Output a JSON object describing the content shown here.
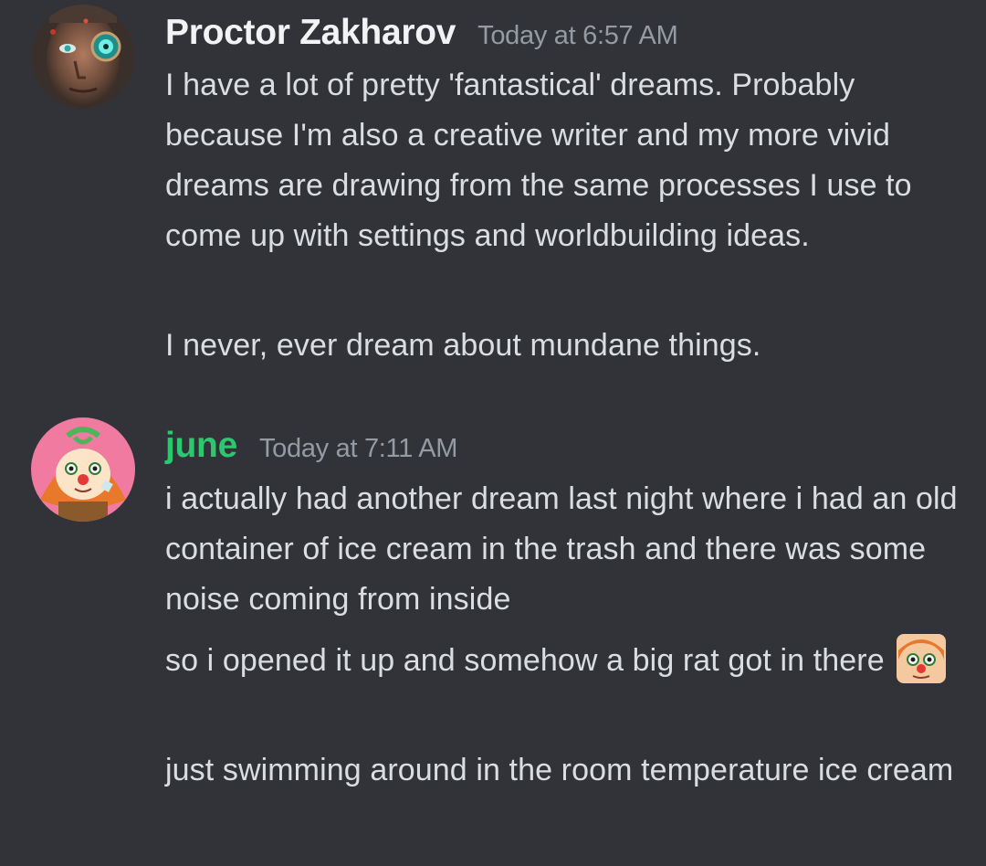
{
  "messages": [
    {
      "author": "Proctor Zakharov",
      "author_color": "#f2f3f5",
      "timestamp": "Today at 6:57 AM",
      "avatar_icon": "cyborg-face-avatar",
      "lines": [
        "I have a lot of pretty 'fantastical' dreams. Probably because I'm also a creative writer and my more vivid dreams are drawing from the same processes I use to come up with settings and worldbuilding ideas.",
        "I never, ever dream about mundane things."
      ]
    },
    {
      "author": "june",
      "author_color": "#2dc770",
      "timestamp": "Today at 7:11 AM",
      "avatar_icon": "clown-girl-avatar",
      "lines": [
        "i actually had another dream last night where i had an old container of ice cream in the trash and there was some noise coming from inside",
        "so i opened it up and somehow a big rat got in there",
        "just swimming around in the room temperature ice cream"
      ],
      "emoji_icon": "clown-face-emoji"
    }
  ]
}
